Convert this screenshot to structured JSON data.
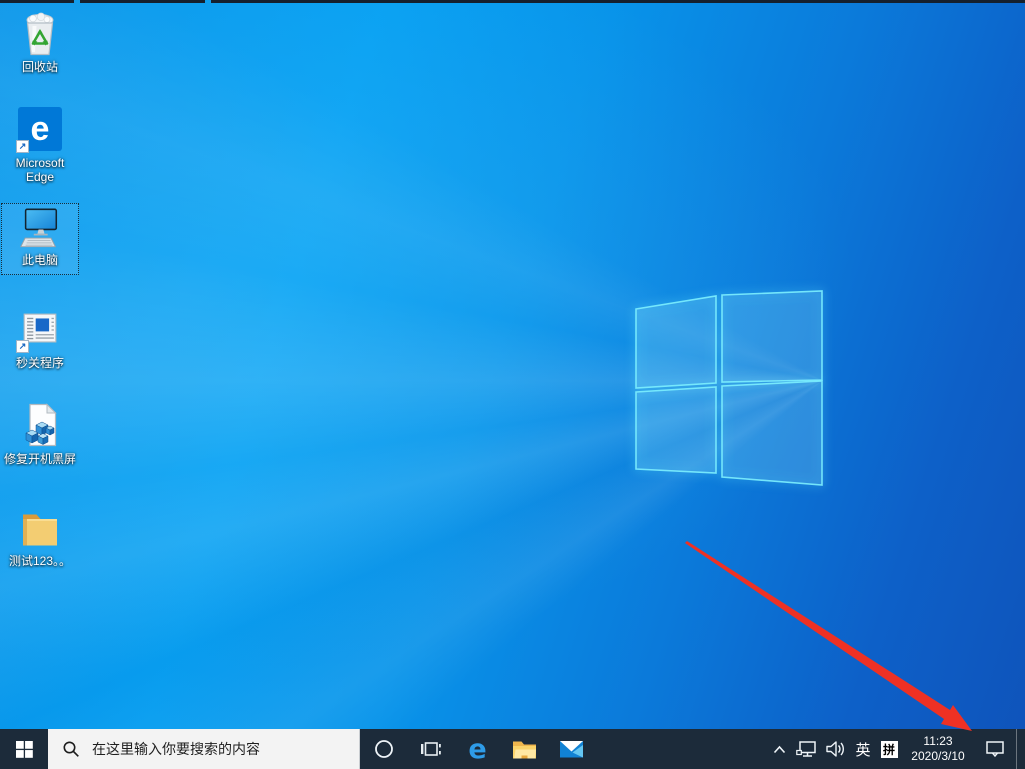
{
  "desktop": {
    "icons": [
      {
        "name": "recycle-bin",
        "label": "回收站",
        "selected": false
      },
      {
        "name": "microsoft-edge",
        "label": "Microsoft Edge",
        "selected": false,
        "shortcut": true
      },
      {
        "name": "this-pc",
        "label": "此电脑",
        "selected": true
      },
      {
        "name": "miaoguan-program",
        "label": "秒关程序",
        "selected": false,
        "shortcut": true
      },
      {
        "name": "fix-boot-black-screen",
        "label": "修复开机黑屏",
        "selected": false
      },
      {
        "name": "test-folder",
        "label": "测试123。。",
        "selected": false
      }
    ],
    "annotation": {
      "type": "red-arrow",
      "points_to": "action-center-icon"
    }
  },
  "taskbar": {
    "start": {
      "icon": "windows-logo"
    },
    "search": {
      "icon": "search-icon",
      "placeholder": "在这里输入你要搜索的内容"
    },
    "apps": [
      {
        "name": "cortana",
        "icon": "cortana-circle-icon"
      },
      {
        "name": "task-view",
        "icon": "task-view-icon"
      },
      {
        "name": "microsoft-edge",
        "icon": "edge-e-icon"
      },
      {
        "name": "file-explorer",
        "icon": "folder-icon"
      },
      {
        "name": "mail",
        "icon": "envelope-icon"
      }
    ],
    "tray": {
      "ime_language": "英",
      "ime_mode": "拼",
      "clock": {
        "time": "11:23",
        "date": "2020/3/10"
      }
    }
  },
  "icons": {
    "edge_glyph": "e"
  },
  "colors": {
    "taskbar_bg": "#1c2b3a",
    "wallpaper_light": "#07a0f2",
    "wallpaper_dark": "#0f53ba",
    "search_bg": "#f3f3f3",
    "arrow_red": "#ee3124",
    "logo_glow": "#7df0fe",
    "edge_blue": "#0078d7",
    "folder_yellow": "#f3cd72"
  }
}
